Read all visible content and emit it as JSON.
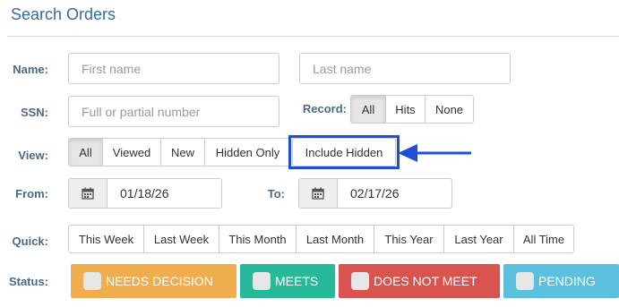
{
  "page": {
    "title": "Search Orders"
  },
  "form": {
    "name_label": "Name:",
    "first_name_placeholder": "First name",
    "last_name_placeholder": "Last name",
    "ssn_label": "SSN:",
    "ssn_placeholder": "Full or partial number",
    "record_label": "Record:",
    "record_options": [
      "All",
      "Hits",
      "None"
    ],
    "view_label": "View:",
    "view_options": [
      "All",
      "Viewed",
      "New",
      "Hidden Only"
    ],
    "include_hidden": "Include Hidden",
    "from_label": "From:",
    "from_value": "01/18/26",
    "to_label": "To:",
    "to_value": "02/17/26",
    "quick_label": "Quick:",
    "quick_options": [
      "This Week",
      "Last Week",
      "This Month",
      "Last Month",
      "This Year",
      "Last Year",
      "All Time"
    ],
    "status_label": "Status:",
    "statuses": [
      {
        "label": "NEEDS DECISION",
        "color": "#f0ad4e"
      },
      {
        "label": "MEETS",
        "color": "#26b99a"
      },
      {
        "label": "DOES NOT MEET",
        "color": "#d9534f"
      },
      {
        "label": "PENDING",
        "color": "#5bc0de"
      }
    ]
  },
  "annotation": {
    "highlight_color": "#1f4fd6",
    "arrow_color": "#1f4fd6"
  },
  "icons": {
    "calendar": "calendar-icon"
  }
}
